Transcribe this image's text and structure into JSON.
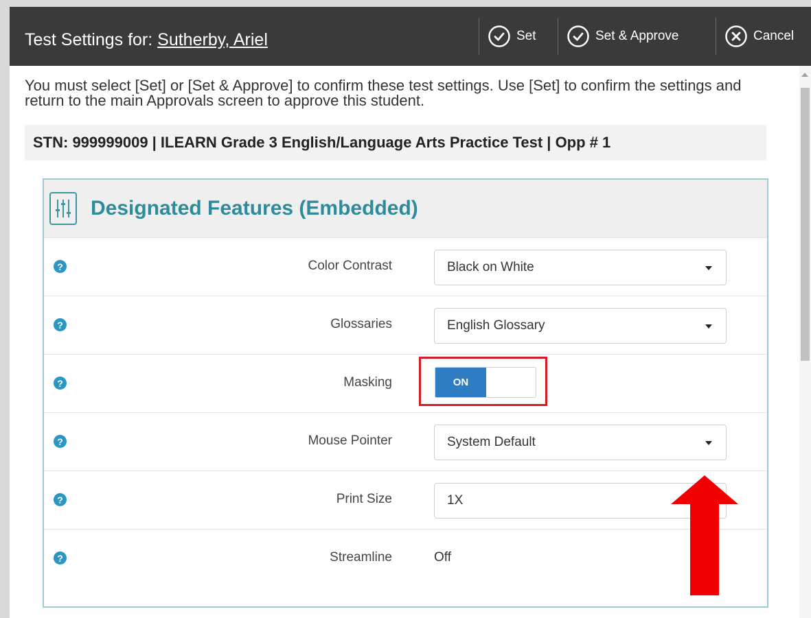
{
  "dialog": {
    "title_prefix": "Test Settings for:",
    "student_name": "Sutherby, Ariel",
    "buttons": {
      "set": "Set",
      "set_approve": "Set & Approve",
      "cancel": "Cancel"
    }
  },
  "notice": "You must select [Set] or [Set & Approve] to confirm these test settings. Use [Set] to confirm the settings and return to the main Approvals screen to approve this student.",
  "stn_line": "STN: 999999009 | ILEARN Grade 3 English/Language Arts Practice Test | Opp # 1",
  "panel": {
    "title": "Designated Features (Embedded)",
    "rows": [
      {
        "label": "Color Contrast",
        "value": "Black on White"
      },
      {
        "label": "Glossaries",
        "value": "English Glossary"
      },
      {
        "label": "Masking",
        "value": "ON"
      },
      {
        "label": "Mouse Pointer",
        "value": "System Default"
      },
      {
        "label": "Print Size",
        "value": "1X"
      },
      {
        "label": "Streamline",
        "value": "Off"
      }
    ]
  },
  "help_glyph": "?",
  "colors": {
    "titlebar": "#3a3a3a",
    "accent": "#2e8b9b",
    "toggle_on": "#2e7cc2",
    "highlight": "#d51d24",
    "arrow": "#f00000"
  }
}
